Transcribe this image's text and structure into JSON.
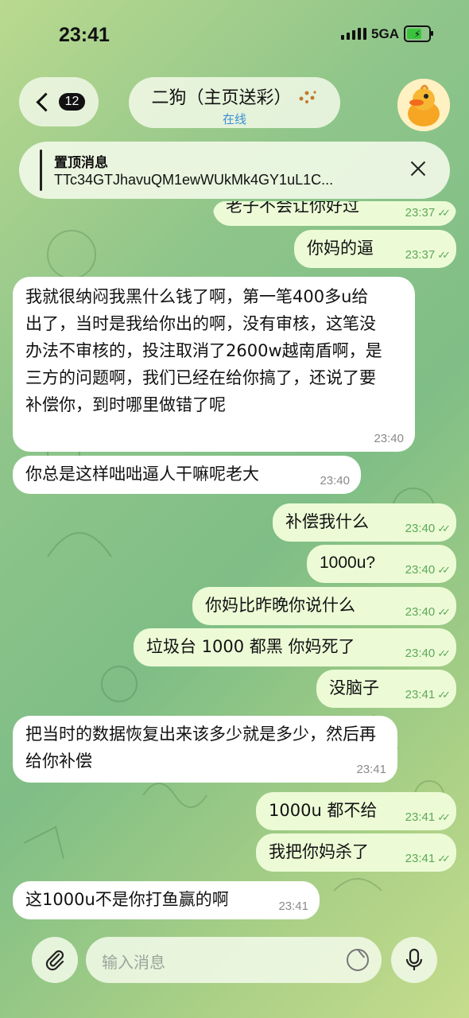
{
  "status": {
    "time": "23:41",
    "network": "5GA",
    "battery_icon": "bolt"
  },
  "header": {
    "back_count": "12",
    "name": "二狗（主页送彩）",
    "status": "在线"
  },
  "pinned": {
    "title": "置顶消息",
    "text": "TTc34GTJhavuQM1ewWUkMk4GY1uL1C..."
  },
  "messages": [
    {
      "dir": "out",
      "text": "老子不会让你好过",
      "time": "23:37"
    },
    {
      "dir": "out",
      "text": "你妈的逼",
      "time": "23:37"
    },
    {
      "dir": "in",
      "text": "我就很纳闷我黑什么钱了啊，第一笔400多u给出了，当时是我给你出的啊，没有审核，这笔没办法不审核的，投注取消了2600w越南盾啊，是三方的问题啊，我们已经在给你搞了，还说了要补偿你，到时哪里做错了呢",
      "time": "23:40"
    },
    {
      "dir": "in",
      "text": "你总是这样咄咄逼人干嘛呢老大",
      "time": "23:40"
    },
    {
      "dir": "out",
      "text": "补偿我什么",
      "time": "23:40"
    },
    {
      "dir": "out",
      "text": "1000u?",
      "time": "23:40"
    },
    {
      "dir": "out",
      "text": "你妈比昨晚你说什么",
      "time": "23:40"
    },
    {
      "dir": "out",
      "text": "垃圾台 1000 都黑 你妈死了",
      "time": "23:40"
    },
    {
      "dir": "out",
      "text": "没脑子",
      "time": "23:41"
    },
    {
      "dir": "in",
      "text": "把当时的数据恢复出来该多少就是多少，然后再给你补偿",
      "time": "23:41"
    },
    {
      "dir": "out",
      "text": "1000u 都不给",
      "time": "23:41"
    },
    {
      "dir": "out",
      "text": "我把你妈杀了",
      "time": "23:41"
    },
    {
      "dir": "in",
      "text": "这1000u不是你打鱼赢的啊",
      "time": "23:41"
    }
  ],
  "composer": {
    "placeholder": "输入消息"
  },
  "colors": {
    "incoming": "#ffffff",
    "outgoing": "#ecfbd6",
    "link": "#3a8fd6"
  }
}
